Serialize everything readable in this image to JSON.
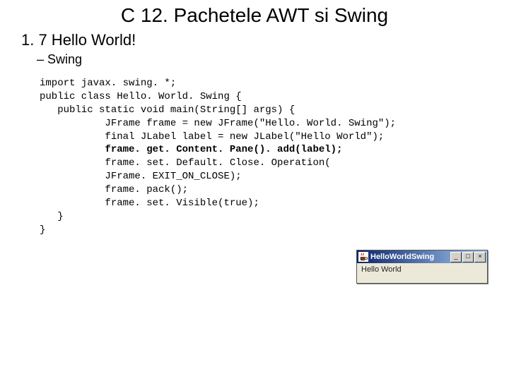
{
  "title": "C 12. Pachetele AWT si Swing",
  "heading": "1. 7 Hello World!",
  "subheading": "– Swing",
  "code": {
    "l1": "import javax. swing. *;",
    "l2": "public class Hello. World. Swing {",
    "l3": "   public static void main(String[] args) {",
    "l4": "           JFrame frame = new JFrame(\"Hello. World. Swing\");",
    "l5": "           final JLabel label = new JLabel(\"Hello World\");",
    "l6": "           frame. get. Content. Pane(). add(label);",
    "l7": "           frame. set. Default. Close. Operation(",
    "l8": "           JFrame. EXIT_ON_CLOSE);",
    "l9": "           frame. pack();",
    "l10": "           frame. set. Visible(true);",
    "l11": "   }",
    "l12": "}"
  },
  "window": {
    "title": "HelloWorldSwing",
    "body": "Hello World",
    "buttons": {
      "min": "_",
      "max": "□",
      "close": "×"
    }
  }
}
